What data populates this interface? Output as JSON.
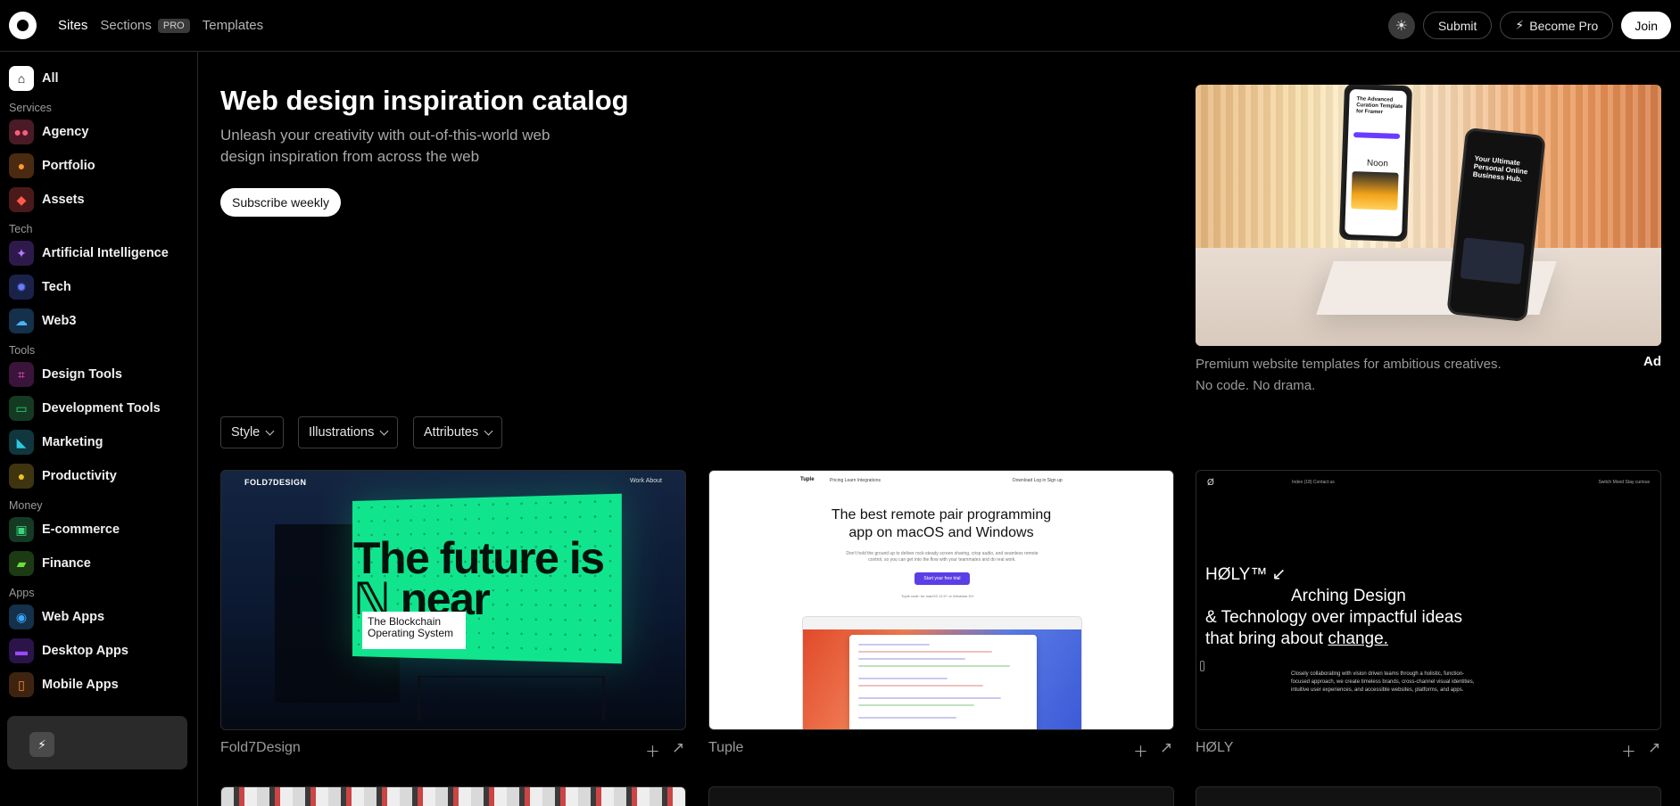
{
  "nav": {
    "links": [
      {
        "label": "Sites",
        "active": true
      },
      {
        "label": "Sections",
        "badge": "PRO"
      },
      {
        "label": "Templates"
      }
    ],
    "submit": "Submit",
    "become_pro": "Become Pro",
    "join": "Join"
  },
  "sidebar": {
    "all": "All",
    "groups": [
      {
        "title": "Services",
        "items": [
          {
            "label": "Agency",
            "icon": "people-icon",
            "color": "#4a1a26"
          },
          {
            "label": "Portfolio",
            "icon": "person-icon",
            "color": "#4a2a10"
          },
          {
            "label": "Assets",
            "icon": "cube-icon",
            "color": "#4a1a1a"
          }
        ]
      },
      {
        "title": "Tech",
        "items": [
          {
            "label": "Artificial Intelligence",
            "icon": "sparkle-icon",
            "color": "#2e1a4a"
          },
          {
            "label": "Tech",
            "icon": "chip-icon",
            "color": "#1a224a"
          },
          {
            "label": "Web3",
            "icon": "cloud-icon",
            "color": "#14304a"
          }
        ]
      },
      {
        "title": "Tools",
        "items": [
          {
            "label": "Design Tools",
            "icon": "vector-icon",
            "color": "#3a143a"
          },
          {
            "label": "Development Tools",
            "icon": "code-icon",
            "color": "#143a24"
          },
          {
            "label": "Marketing",
            "icon": "tag-icon",
            "color": "#10363e"
          },
          {
            "label": "Productivity",
            "icon": "person-check-icon",
            "color": "#3e3410"
          }
        ]
      },
      {
        "title": "Money",
        "items": [
          {
            "label": "E-commerce",
            "icon": "bag-icon",
            "color": "#143a24"
          },
          {
            "label": "Finance",
            "icon": "wallet-icon",
            "color": "#1c3a14"
          }
        ]
      },
      {
        "title": "Apps",
        "items": [
          {
            "label": "Web Apps",
            "icon": "compass-icon",
            "color": "#14304a"
          },
          {
            "label": "Desktop Apps",
            "icon": "monitor-icon",
            "color": "#2a144a"
          },
          {
            "label": "Mobile Apps",
            "icon": "phone-icon",
            "color": "#3e2410"
          }
        ]
      }
    ]
  },
  "hero": {
    "title": "Web design inspiration catalog",
    "subtitle": "Unleash your creativity with out-of-this-world web design inspiration from across the web",
    "subscribe": "Subscribe weekly"
  },
  "ad": {
    "caption_line1": "Premium website templates for ambitious creatives.",
    "caption_line2": "No code. No drama.",
    "tag": "Ad",
    "phone1_text": "The Advanced Curation Template for Framer",
    "phone1_label": "Noon",
    "phone2_text": "Your Ultimate Personal Online Business Hub."
  },
  "filters": [
    "Style",
    "Illustrations",
    "Attributes"
  ],
  "cards": [
    {
      "name": "Fold7Design",
      "brand": "FOLD7DESIGN",
      "links": "Work   About",
      "headline": "The future is ℕ near",
      "note": "The Blockchain Operating System"
    },
    {
      "name": "Tuple",
      "brand": "Tuple",
      "nav_items": "Pricing   Learn   Integrations",
      "nav_right": "Download   Log in   Sign up",
      "headline": "The best remote pair programming app on macOS and Windows",
      "blurb": "Don't hold the ground up to deliver rock-steady screen sharing, crisp audio, and seamless remote control, so you can get into the flow with your teammates and do real work.",
      "cta": "Start your free trial",
      "mini": "Tuple code: for macOS 12.0+ or Windows 10+"
    },
    {
      "name": "HØLY",
      "logo": "Ø",
      "links_mid": "Index (18)   Contact us",
      "links_right": "Switch Mood   Stay curious",
      "headline_a": "HØLY™        ↙",
      "headline_b": "Arching Design",
      "headline_c": "& Technology over impactful ideas",
      "headline_d_pre": "that bring about ",
      "headline_d_link": "change.",
      "para": "Closely collaborating with vision driven teams through a holistic, function-focused approach, we create timeless brands, cross-channel visual identities, intuitive user experiences, and accessible websites, platforms, and apps."
    }
  ]
}
